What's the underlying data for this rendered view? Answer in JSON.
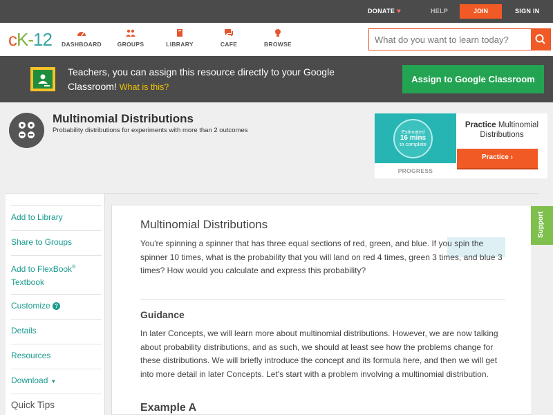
{
  "topbar": {
    "donate": "DONATE",
    "help": "HELP",
    "join": "JOIN",
    "signin": "SIGN IN"
  },
  "logo": {
    "c": "c",
    "k": "K-",
    "n": "12"
  },
  "nav": {
    "dashboard": "DASHBOARD",
    "groups": "GROUPS",
    "library": "LIBRARY",
    "cafe": "CAFE",
    "browse": "BROWSE"
  },
  "search": {
    "placeholder": "What do you want to learn today?"
  },
  "banner": {
    "text": "Teachers, you can assign this resource directly to your Google Classroom!",
    "link": "What is this?",
    "button": "Assign to Google Classroom"
  },
  "concept": {
    "title": "Multinomial Distributions",
    "subtitle": "Probability distributions for experiments with more than 2 outcomes"
  },
  "practice": {
    "estimated": "Estimated",
    "minutes": "16 mins",
    "to_complete": "to complete",
    "progress": "PROGRESS",
    "title_bold": "Practice",
    "title_rest": "Multinomial Distributions",
    "button": "Practice"
  },
  "sidebar": {
    "add_library": "Add to Library",
    "share_groups": "Share to Groups",
    "add_flexbook": "Add to FlexBook",
    "reg": "®",
    "textbook": "Textbook",
    "customize": "Customize",
    "qmark": "?",
    "details": "Details",
    "resources": "Resources",
    "download": "Download",
    "quick_tips": "Quick Tips"
  },
  "article": {
    "title": "Multinomial Distributions",
    "intro": "You're spinning a spinner that has three equal sections of red, green, and blue. If you spin the spinner 10 times, what is the probability that you will land on red 4 times, green 3 times, and blue 3 times? How would you calculate and express this probability?",
    "guidance_heading": "Guidance",
    "guidance": "In later Concepts, we will learn more about multinomial distributions. However, we are now talking about probability distributions, and as such, we should at least see how the problems change for these distributions. We will briefly introduce the concept and its formula here, and then we will get into more detail in later Concepts. Let's start with a problem involving a multinomial distribution.",
    "example_heading": "Example A"
  },
  "support": "Support",
  "colors": {
    "accent": "#f15a24",
    "teal": "#1a9a8f",
    "green": "#23a452",
    "dark": "#4b4b4b"
  }
}
